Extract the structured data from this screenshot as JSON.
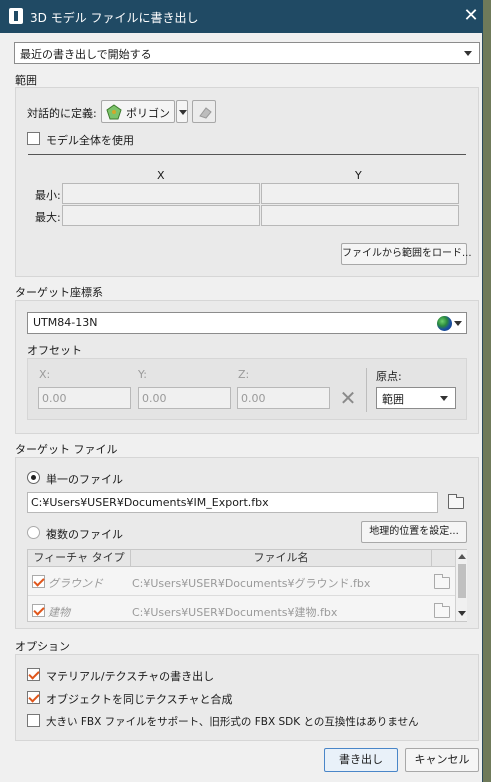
{
  "window": {
    "title": "3D モデル ファイルに書き出し",
    "close": "✕"
  },
  "preset": {
    "value": "最近の書き出しで開始する"
  },
  "extent": {
    "section_label": "範囲",
    "define_label": "対話的に定義:",
    "polygon_button": "ポリゴン",
    "use_full_model": "モデル全体を使用",
    "col_x": "X",
    "col_y": "Y",
    "min_label": "最小:",
    "max_label": "最大:",
    "load_button": "ファイルから範囲をロード..."
  },
  "target_cs": {
    "section_label": "ターゲット座標系",
    "value": "UTM84-13N",
    "offset_label": "オフセット",
    "x_label": "X:",
    "y_label": "Y:",
    "z_label": "Z:",
    "x_value": "0.00",
    "y_value": "0.00",
    "z_value": "0.00",
    "origin_label": "原点:",
    "origin_value": "範囲"
  },
  "target_file": {
    "section_label": "ターゲット ファイル",
    "single_label": "単一のファイル",
    "single_path": "C:¥Users¥USER¥Documents¥IM_Export.fbx",
    "multiple_label": "複数のファイル",
    "geo_button": "地理的位置を設定...",
    "table": {
      "col_type": "フィーチャ タイプ",
      "col_file": "ファイル名",
      "rows": [
        {
          "type": "グラウンド",
          "file": "C:¥Users¥USER¥Documents¥グラウンド.fbx",
          "checked": true
        },
        {
          "type": "建物",
          "file": "C:¥Users¥USER¥Documents¥建物.fbx",
          "checked": true
        }
      ]
    }
  },
  "options": {
    "section_label": "オプション",
    "opt1": "マテリアル/テクスチャの書き出し",
    "opt2": "オブジェクトを同じテクスチャと合成",
    "opt3": "大きい FBX ファイルをサポート、旧形式の FBX SDK との互換性はありません"
  },
  "footer": {
    "export_button": "書き出し",
    "cancel_button": "キャンセル"
  },
  "colors": {
    "titlebar": "#204a64",
    "check_accent": "#e0561b",
    "primary_border": "#4a86c8"
  }
}
